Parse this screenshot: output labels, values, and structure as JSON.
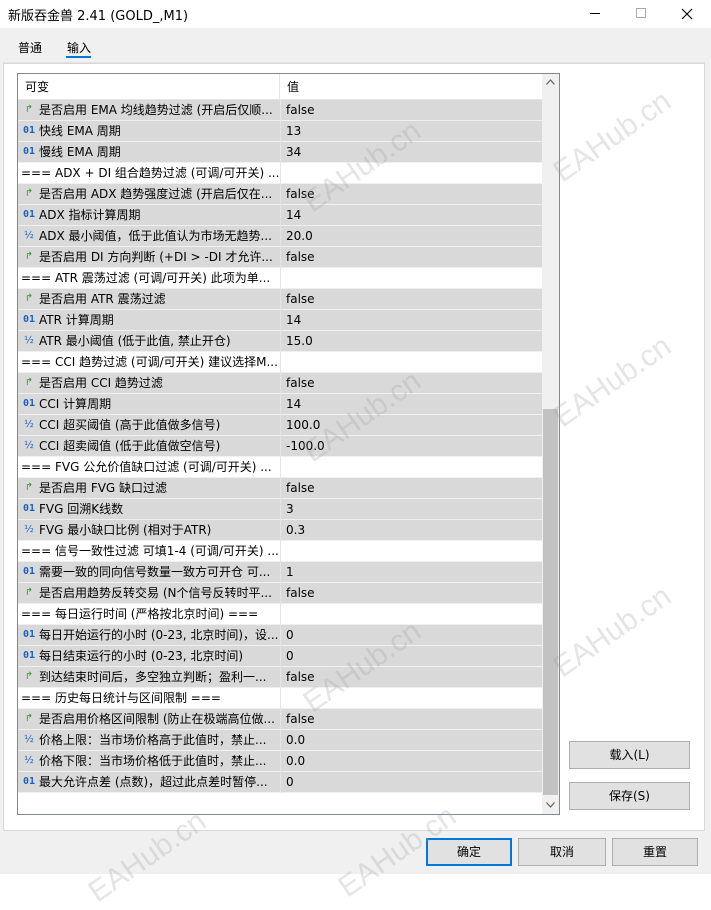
{
  "window": {
    "title": "新版吞金兽 2.41 (GOLD_,M1)"
  },
  "tabs": [
    {
      "label": "普通"
    },
    {
      "label": "输入"
    }
  ],
  "grid": {
    "columns": {
      "name": "可变",
      "value": "值"
    },
    "rows": [
      {
        "type": "bool",
        "name": "是否启用 EMA 均线趋势过滤 (开启后仅顺...",
        "value": "false"
      },
      {
        "type": "int",
        "name": "快线 EMA 周期",
        "value": "13"
      },
      {
        "type": "int",
        "name": "慢线 EMA 周期",
        "value": "34"
      },
      {
        "type": "header",
        "name": "=== ADX + DI 组合趋势过滤 (可调/可开关) ...",
        "value": ""
      },
      {
        "type": "bool",
        "name": "是否启用 ADX 趋势强度过滤 (开启后仅在...",
        "value": "false"
      },
      {
        "type": "int",
        "name": "ADX 指标计算周期",
        "value": "14"
      },
      {
        "type": "double",
        "name": "ADX 最小阈值，低于此值认为市场无趋势...",
        "value": "20.0"
      },
      {
        "type": "bool",
        "name": "是否启用 DI 方向判断 (+DI > -DI 才允许...",
        "value": "false"
      },
      {
        "type": "header",
        "name": "=== ATR 震荡过滤 (可调/可开关) 此项为单...",
        "value": ""
      },
      {
        "type": "bool",
        "name": "是否启用 ATR 震荡过滤",
        "value": "false"
      },
      {
        "type": "int",
        "name": "ATR 计算周期",
        "value": "14"
      },
      {
        "type": "double",
        "name": "ATR 最小阈值 (低于此值, 禁止开仓)",
        "value": "15.0"
      },
      {
        "type": "header",
        "name": "=== CCI 趋势过滤 (可调/可开关) 建议选择M...",
        "value": ""
      },
      {
        "type": "bool",
        "name": "是否启用 CCI 趋势过滤",
        "value": "false"
      },
      {
        "type": "int",
        "name": "CCI 计算周期",
        "value": "14"
      },
      {
        "type": "double",
        "name": "CCI 超买阈值 (高于此值做多信号)",
        "value": "100.0"
      },
      {
        "type": "double",
        "name": "CCI 超卖阈值 (低于此值做空信号)",
        "value": "-100.0"
      },
      {
        "type": "header",
        "name": "=== FVG 公允价值缺口过滤 (可调/可开关) ...",
        "value": ""
      },
      {
        "type": "bool",
        "name": "是否启用 FVG 缺口过滤",
        "value": "false"
      },
      {
        "type": "int",
        "name": "FVG 回溯K线数",
        "value": "3"
      },
      {
        "type": "double",
        "name": "FVG 最小缺口比例 (相对于ATR)",
        "value": "0.3"
      },
      {
        "type": "header",
        "name": "=== 信号一致性过滤 可填1-4 (可调/可开关) ...",
        "value": ""
      },
      {
        "type": "int",
        "name": "需要一致的同向信号数量一致方可开仓 可...",
        "value": "1"
      },
      {
        "type": "bool",
        "name": "是否启用趋势反转交易 (N个信号反转时平...",
        "value": "false"
      },
      {
        "type": "header",
        "name": "=== 每日运行时间 (严格按北京时间) ===",
        "value": ""
      },
      {
        "type": "int",
        "name": "每日开始运行的小时 (0-23, 北京时间)，设...",
        "value": "0"
      },
      {
        "type": "int",
        "name": "每日结束运行的小时 (0-23, 北京时间)",
        "value": "0"
      },
      {
        "type": "bool",
        "name": "到达结束时间后，多空独立判断；盈利一...",
        "value": "false"
      },
      {
        "type": "header",
        "name": "=== 历史每日统计与区间限制 ===",
        "value": ""
      },
      {
        "type": "bool",
        "name": "是否启用价格区间限制 (防止在极端高位做...",
        "value": "false"
      },
      {
        "type": "double",
        "name": "价格上限：当市场价格高于此值时，禁止...",
        "value": "0.0"
      },
      {
        "type": "double",
        "name": "价格下限：当市场价格低于此值时，禁止...",
        "value": "0.0"
      },
      {
        "type": "int",
        "name": "最大允许点差 (点数)，超过此点差时暂停...",
        "value": "0"
      }
    ]
  },
  "icons": {
    "bool": "bool-arrow-icon",
    "int": "int-icon",
    "double": "double-icon"
  },
  "icon_glyphs": {
    "bool": "↱",
    "int": "01",
    "double": "½"
  },
  "buttons": {
    "load": "载入(L)",
    "save": "保存(S)",
    "ok": "确定",
    "cancel": "取消",
    "reset": "重置"
  },
  "watermark": "EAHub.cn",
  "colors": {
    "accent": "#0078d7",
    "selected_row": "#d9d9d9",
    "bool_icon": "#2a9d2a",
    "num_icon": "#1f5fbf"
  }
}
